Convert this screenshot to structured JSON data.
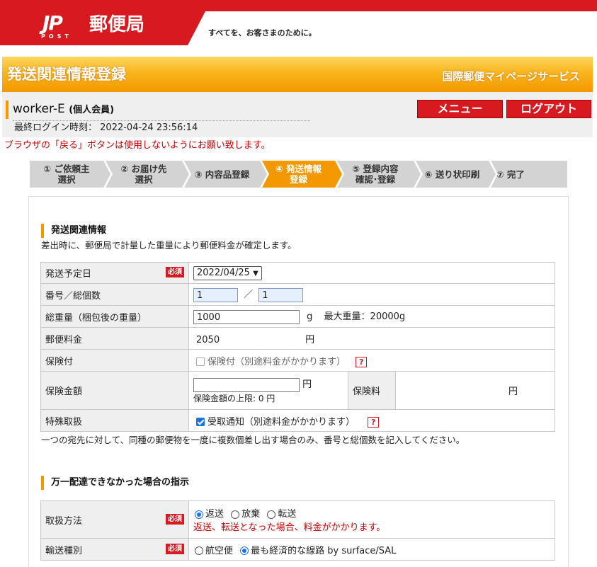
{
  "brand": {
    "logo_jp": "JP",
    "logo_post": "POST",
    "logo_name": "郵便局",
    "tagline": "すべてを、お客さまのために。",
    "red": "#d71920",
    "orange": "#f39800"
  },
  "header": {
    "title": "発送関連情報登録",
    "service": "国際郵便マイページサービス"
  },
  "user": {
    "name": "worker-E",
    "type": "(個人会員)",
    "last_login_label": "最終ログイン時刻：",
    "last_login_value": "2022-04-24 23:56:14",
    "menu_label": "メニュー",
    "logout_label": "ログアウト"
  },
  "warning": "ブラウザの「戻る」ボタンは使用しないようにお願い致します。",
  "steps": [
    {
      "line1": "① ご依頼主",
      "line2": "選択",
      "active": false
    },
    {
      "line1": "② お届け先",
      "line2": "選択",
      "active": false
    },
    {
      "line1": "③ 内容品登録",
      "line2": "",
      "active": false
    },
    {
      "line1": "④ 発送情報",
      "line2": "登録",
      "active": true
    },
    {
      "line1": "⑤ 登録内容",
      "line2": "確認･登録",
      "active": false
    },
    {
      "line1": "⑥ 送り状印刷",
      "line2": "",
      "active": false
    },
    {
      "line1": "⑦ 完了",
      "line2": "",
      "active": false
    }
  ],
  "section1": {
    "title": "発送関連情報",
    "note": "差出時に、郵便局で計量した重量により郵便料金が確定します。",
    "required_badge": "必須",
    "ship_date_label": "発送予定日",
    "ship_date_value": "2022/04/25",
    "count_label": "番号／総個数",
    "count_number": "1",
    "count_sep": "／",
    "count_total": "1",
    "weight_label": "総重量（梱包後の重量）",
    "weight_value": "1000",
    "weight_unit": "g",
    "weight_max": "最大重量：20000g",
    "postage_label": "郵便料金",
    "postage_value": "2050",
    "postage_unit": "円",
    "insurance_label": "保険付",
    "insurance_option": "保険付（別途料金がかかります）",
    "insured_amount_label": "保険金額",
    "insured_amount_unit": "円",
    "insured_amount_limit": "保険金額の上限: 0 円",
    "insurance_fee_label": "保険料",
    "insurance_fee_unit": "円",
    "special_label": "特殊取扱",
    "special_option": "受取通知（別途料金がかかります）",
    "help_mark": "?",
    "footnote": "一つの宛先に対して、同種の郵便物を一度に複数個差し出す場合のみ、番号と総個数を記入してください。"
  },
  "section2": {
    "title": "万一配達できなかった場合の指示",
    "handling_label": "取扱方法",
    "handling_options": [
      "返送",
      "放棄",
      "転送"
    ],
    "handling_selected": "返送",
    "handling_note": "返送、転送となった場合、料金がかかります。",
    "transport_label": "輸送種別",
    "transport_options": [
      "航空便",
      "最も経済的な線路 by surface/SAL"
    ],
    "transport_selected": "最も経済的な線路 by surface/SAL"
  }
}
